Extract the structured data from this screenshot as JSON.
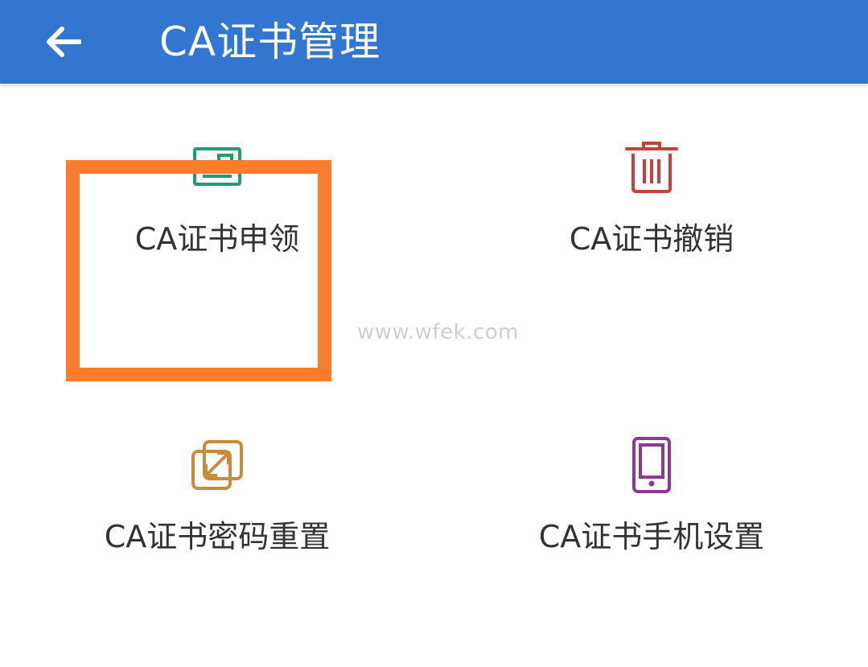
{
  "header": {
    "title": "CA证书管理",
    "back_icon": "arrow-left-icon",
    "background_color": "#3276d2"
  },
  "tiles": [
    {
      "label": "CA证书申领",
      "icon": "certificate-card-icon",
      "color": "#1e9e6e"
    },
    {
      "label": "CA证书撤销",
      "icon": "trash-icon",
      "color": "#c8403a"
    },
    {
      "label": "CA证书密码重置",
      "icon": "swap-arrows-icon",
      "color": "#c98a3a"
    },
    {
      "label": "CA证书手机设置",
      "icon": "mobile-phone-icon",
      "color": "#8a3a93"
    }
  ],
  "highlight": {
    "target": "CA证书申领",
    "color": "#fb7c2c"
  },
  "watermark": "www.wfek.com"
}
